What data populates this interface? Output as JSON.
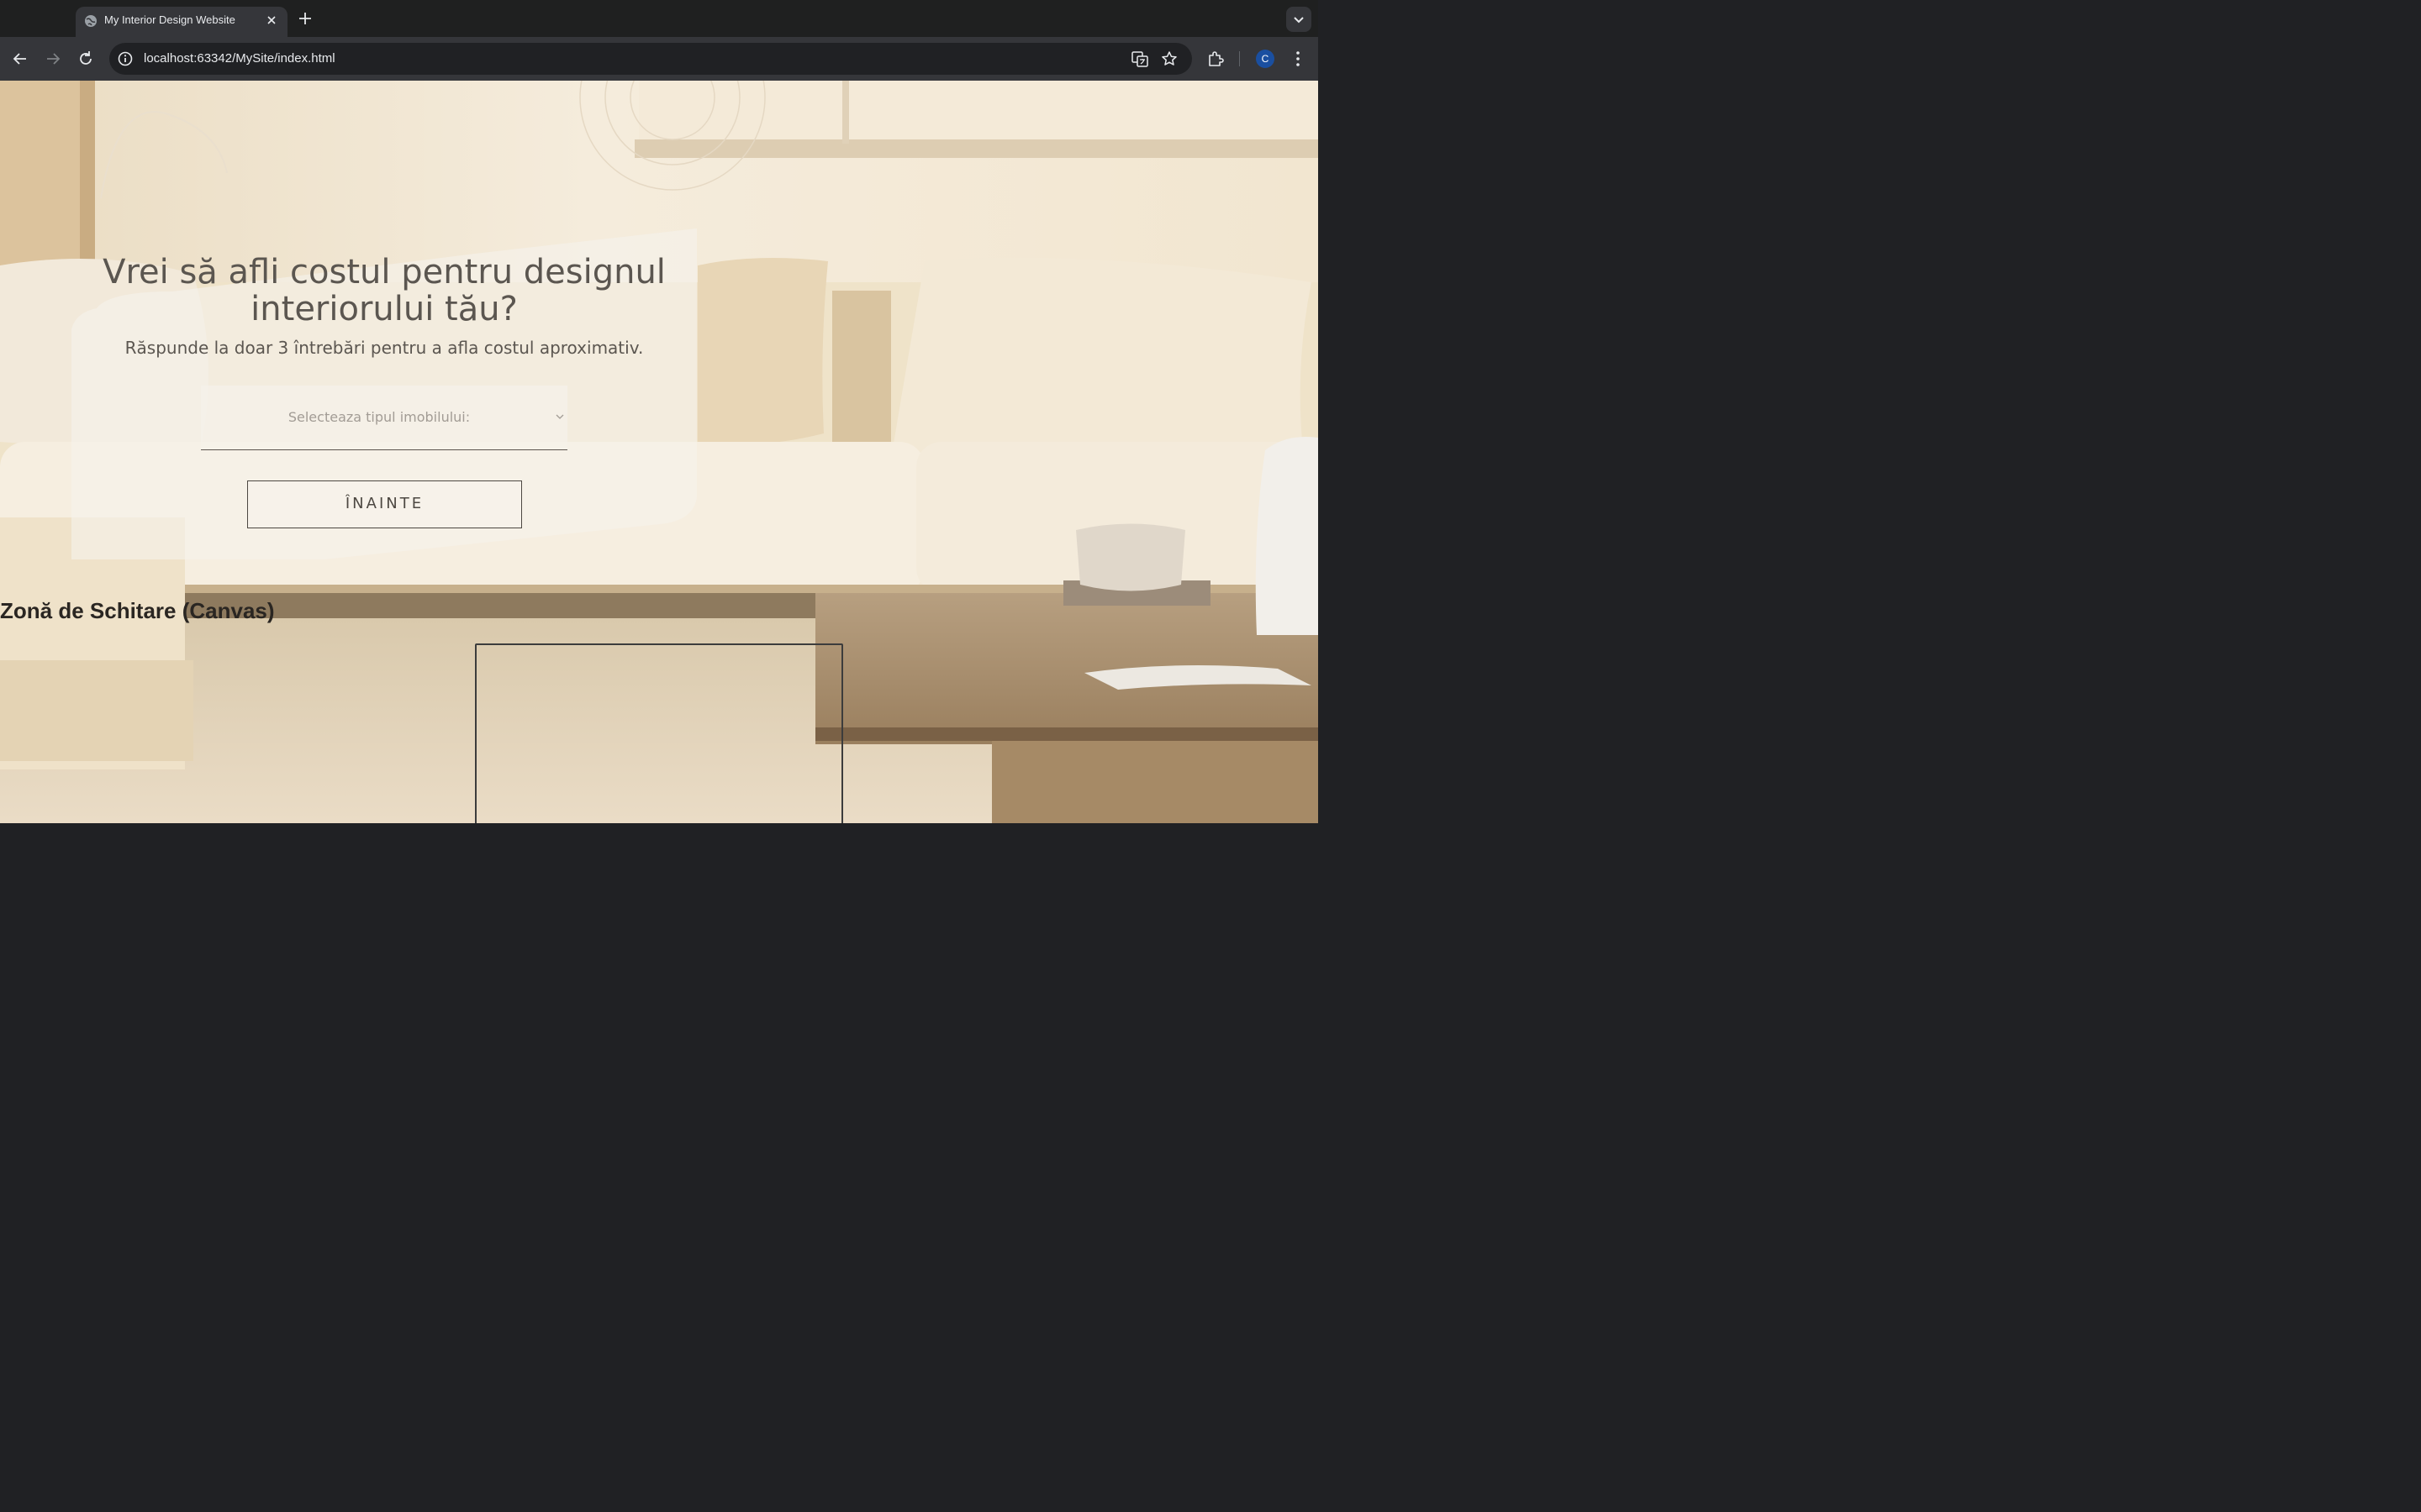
{
  "browser": {
    "tab_title": "My Interior Design Website",
    "url": "localhost:63342/MySite/index.html",
    "avatar_letter": "C"
  },
  "hero": {
    "title": "Vrei să afli costul pentru designul interiorului tău?",
    "subtitle": "Răspunde la doar 3 întrebări pentru a afla costul aproximativ.",
    "select_placeholder": "Selecteaza tipul imobilului:",
    "next_button": "ÎNAINTE"
  },
  "canvas_section": {
    "heading": "Zonă de Schitare (Canvas)"
  },
  "colors": {
    "chrome_dark": "#1f2020",
    "chrome_toolbar": "#35363a",
    "text_primary": "#5b5650",
    "wall": "#f1e7d5",
    "sofa": "#efe2c6"
  }
}
